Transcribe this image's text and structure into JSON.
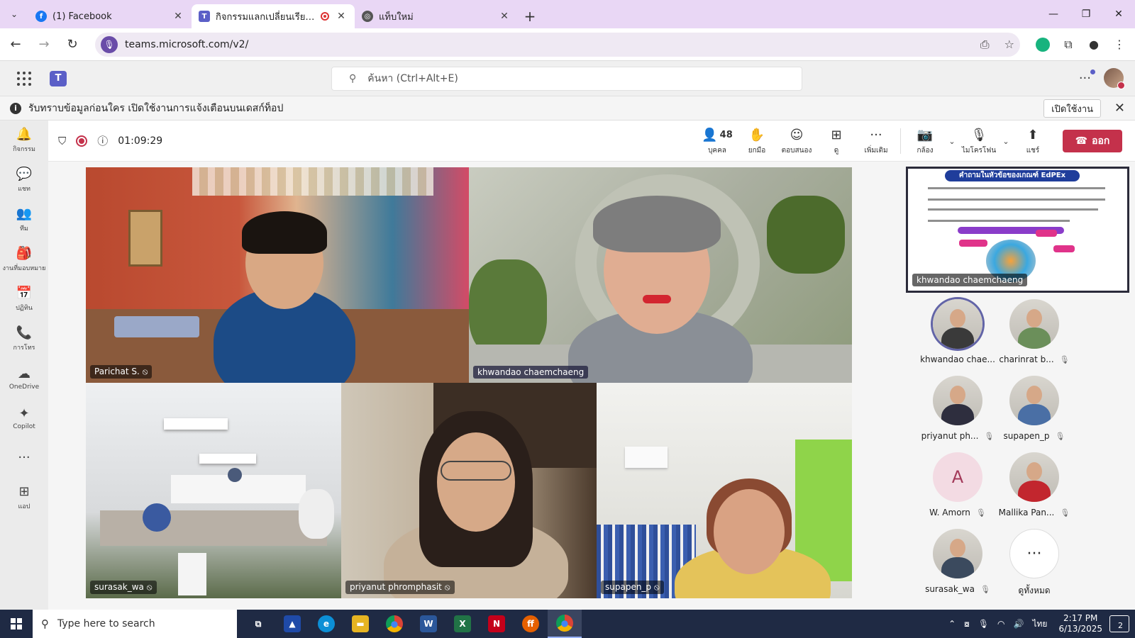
{
  "browser": {
    "tabs": [
      {
        "title": "(1) Facebook",
        "icon": "facebook-icon",
        "color": "#1877f2",
        "active": false
      },
      {
        "title": "กิจกรรมแลกเปลี่ยนเรียนรู้ SAR",
        "icon": "teams-icon",
        "color": "#5b5fc7",
        "active": true
      },
      {
        "title": "แท็บใหม่",
        "icon": "chrome-icon",
        "color": "#555555",
        "active": false
      }
    ],
    "url": "teams.microsoft.com/v2/"
  },
  "teams": {
    "search_placeholder": "ค้นหา (Ctrl+Alt+E)",
    "notification": {
      "text": "รับทราบข้อมูลก่อนใคร เปิดใช้งานการแจ้งเตือนบนเดสก์ท็อป",
      "button": "เปิดใช้งาน"
    },
    "rail": [
      {
        "label": "กิจกรรม",
        "icon": "bell-icon",
        "glyph": "🔔"
      },
      {
        "label": "แชท",
        "icon": "chat-icon",
        "glyph": "💬"
      },
      {
        "label": "ทีม",
        "icon": "teams-people-icon",
        "glyph": "👥"
      },
      {
        "label": "งานที่มอบหมาย",
        "icon": "assignments-icon",
        "glyph": "🎒"
      },
      {
        "label": "ปฏิทิน",
        "icon": "calendar-icon",
        "glyph": "📅"
      },
      {
        "label": "การโทร",
        "icon": "phone-icon",
        "glyph": "📞"
      },
      {
        "label": "OneDrive",
        "icon": "cloud-icon",
        "glyph": "☁"
      },
      {
        "label": "Copilot",
        "icon": "copilot-icon",
        "glyph": "✦"
      },
      {
        "label": "",
        "icon": "more-icon",
        "glyph": "···"
      },
      {
        "label": "แอป",
        "icon": "apps-plus-icon",
        "glyph": "⊞"
      }
    ]
  },
  "meeting": {
    "timer": "01:09:29",
    "controls": {
      "people_count": "48",
      "people": "บุคคล",
      "raise": "ยกมือ",
      "react": "ตอบสนอง",
      "view": "ดู",
      "more": "เพิ่มเติม",
      "camera": "กล้อง",
      "mic": "ไมโครโฟน",
      "share": "แชร์",
      "leave": "ออก"
    },
    "tiles": [
      {
        "name": "Parichat S.",
        "muted": true
      },
      {
        "name": "khwandao chaemchaeng",
        "muted": false,
        "speaking": true
      },
      {
        "name": "surasak_wa",
        "muted": true
      },
      {
        "name": "priyanut phromphasit",
        "muted": true
      },
      {
        "name": "supapen_p",
        "muted": true
      }
    ],
    "shared_content": {
      "presenter": "khwandao chaemchaeng",
      "slide_title": "คำถามในหัวข้อของเกณฑ์ EdPEx"
    },
    "roster": [
      {
        "name": "khwandao chae...",
        "muted": false,
        "speaking": true,
        "avatar_color": "#3a3a3a"
      },
      {
        "name": "charinrat b...",
        "muted": true,
        "avatar_color": "#6b8f5a"
      },
      {
        "name": "priyanut ph...",
        "muted": true,
        "avatar_color": "#2e2e3e"
      },
      {
        "name": "supapen_p",
        "muted": true,
        "avatar_color": "#4a6fa5"
      },
      {
        "name": "W. Amorn",
        "muted": true,
        "initial": "A",
        "avatar_color": "#f3dbe3"
      },
      {
        "name": "Mallika Pan...",
        "muted": true,
        "avatar_color": "#c2262e"
      },
      {
        "name": "surasak_wa",
        "muted": true,
        "avatar_color": "#3b4a5e"
      },
      {
        "name": "ดูทั้งหมด",
        "more": true,
        "glyph": "···"
      }
    ]
  },
  "taskbar": {
    "search_placeholder": "Type here to search",
    "apps": [
      {
        "name": "task-view",
        "label": "⧉",
        "color": "transparent"
      },
      {
        "name": "app-blue",
        "label": "▲",
        "color": "#1f4aa8"
      },
      {
        "name": "edge",
        "label": "e",
        "color": "#0c8fd6"
      },
      {
        "name": "file-explorer",
        "label": "▬",
        "color": "#e6b422"
      },
      {
        "name": "chrome",
        "label": "●",
        "color": "#db4437"
      },
      {
        "name": "word",
        "label": "W",
        "color": "#2b579a"
      },
      {
        "name": "excel",
        "label": "X",
        "color": "#217346"
      },
      {
        "name": "app-n",
        "label": "N",
        "color": "#c4001a"
      },
      {
        "name": "firefox",
        "label": "ff",
        "color": "#e66000"
      },
      {
        "name": "chrome-active",
        "label": "●",
        "color": "#db4437",
        "active": true
      }
    ],
    "lang": "ไทย",
    "time": "2:17 PM",
    "date": "6/13/2025",
    "notif_count": "2"
  }
}
